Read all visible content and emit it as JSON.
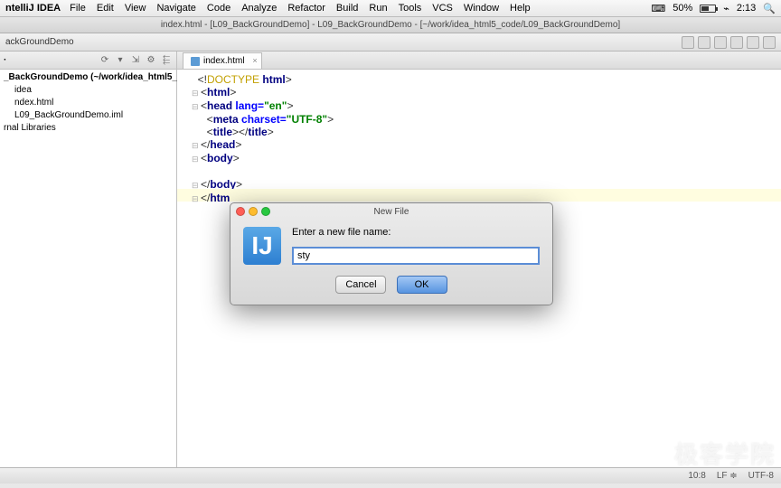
{
  "menubar": {
    "app": "ntelliJ IDEA",
    "items": [
      "File",
      "Edit",
      "View",
      "Navigate",
      "Code",
      "Analyze",
      "Refactor",
      "Build",
      "Run",
      "Tools",
      "VCS",
      "Window",
      "Help"
    ],
    "battery_pct": "50%",
    "time": "2:13"
  },
  "titlebar": "index.html - [L09_BackGroundDemo] - L09_BackGroundDemo - [~/work/idea_html5_code/L09_BackGroundDemo]",
  "breadcrumb": "ackGroundDemo",
  "project": {
    "root": "_BackGroundDemo (~/work/idea_html5_cc",
    "items": [
      "idea",
      "ndex.html",
      "L09_BackGroundDemo.iml",
      "rnal Libraries"
    ]
  },
  "tab": {
    "label": "index.html"
  },
  "code": {
    "l1": "<!DOCTYPE html>",
    "l2": "<html>",
    "l3a": "<head ",
    "l3attr": "lang=",
    "l3val": "\"en\"",
    "l3b": ">",
    "l4a": "    <meta ",
    "l4attr": "charset=",
    "l4val": "\"UTF-8\"",
    "l4b": ">",
    "l5": "    <title></title>",
    "l6": "</head>",
    "l7": "<body>",
    "l8": "",
    "l9": "</body>",
    "l10": "</htm"
  },
  "dialog": {
    "title": "New File",
    "prompt": "Enter a new file name:",
    "value": "sty",
    "cancel": "Cancel",
    "ok": "OK"
  },
  "status": {
    "pos": "10:8",
    "line_sep": "LF ≑",
    "enc": "UTF-8"
  },
  "watermark": "极客学院"
}
